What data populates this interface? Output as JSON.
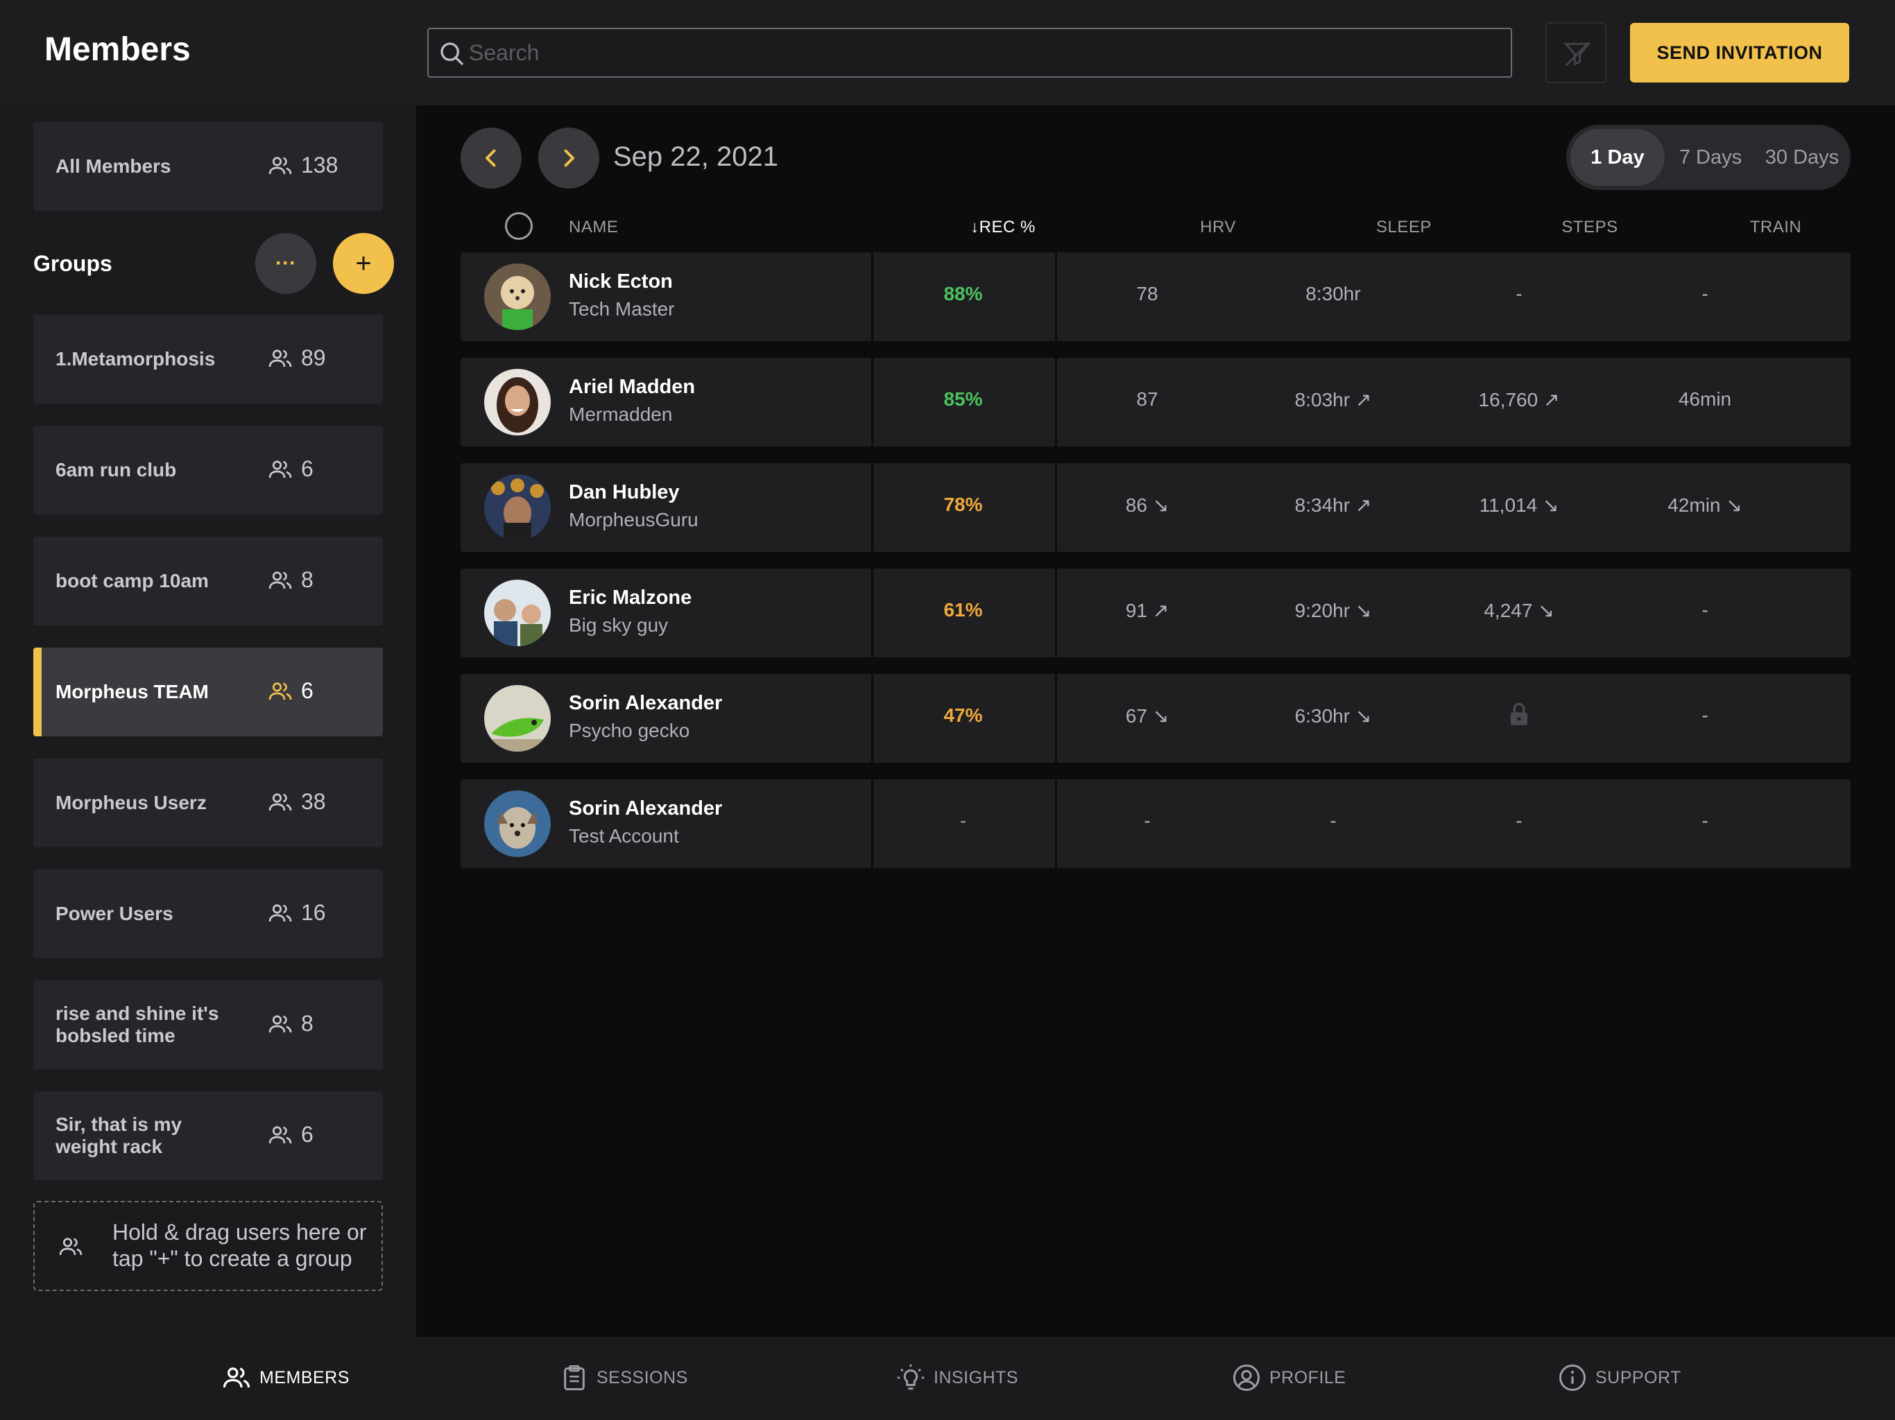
{
  "header": {
    "title": "Members",
    "search_placeholder": "Search",
    "invite_label": "SEND INVITATION"
  },
  "sidebar": {
    "all_members": {
      "label": "All Members",
      "count": "138"
    },
    "groups_label": "Groups",
    "more_label": "···",
    "add_label": "+",
    "groups": [
      {
        "label": "1.Metamorphosis",
        "count": "89"
      },
      {
        "label": "6am run club",
        "count": "6"
      },
      {
        "label": "boot camp 10am",
        "count": "8"
      },
      {
        "label": "Morpheus TEAM",
        "count": "6",
        "active": true
      },
      {
        "label": "Morpheus Userz",
        "count": "38"
      },
      {
        "label": "Power Users",
        "count": "16"
      },
      {
        "label": "rise and shine it's bobsled time",
        "count": "8"
      },
      {
        "label": "Sir, that is my weight rack",
        "count": "6"
      }
    ],
    "dropzone_text": "Hold & drag users here or tap \"+\" to create a group"
  },
  "toolbar": {
    "date": "Sep 22, 2021",
    "ranges": [
      "1 Day",
      "7 Days",
      "30 Days"
    ],
    "selected_range": "1 Day"
  },
  "table": {
    "headers": {
      "name": "NAME",
      "rec": "REC %",
      "hrv": "HRV",
      "sleep": "SLEEP",
      "steps": "STEPS",
      "train": "TRAIN"
    },
    "rows": [
      {
        "name": "Nick Ecton",
        "subtitle": "Tech Master",
        "rec": "88%",
        "rec_color": "#4cc35e",
        "hrv": "78",
        "sleep": "8:30hr",
        "steps": "-",
        "train": "-"
      },
      {
        "name": "Ariel Madden",
        "subtitle": "Mermadden",
        "rec": "85%",
        "rec_color": "#4cc35e",
        "hrv": "87",
        "sleep": "8:03hr ↗",
        "steps": "16,760 ↗",
        "train": "46min"
      },
      {
        "name": "Dan Hubley",
        "subtitle": "MorpheusGuru",
        "rec": "78%",
        "rec_color": "#f0a93a",
        "hrv": "86 ↘",
        "sleep": "8:34hr ↗",
        "steps": "11,014 ↘",
        "train": "42min ↘"
      },
      {
        "name": "Eric Malzone",
        "subtitle": "Big sky guy",
        "rec": "61%",
        "rec_color": "#f0a93a",
        "hrv": "91 ↗",
        "sleep": "9:20hr ↘",
        "steps": "4,247 ↘",
        "train": "-"
      },
      {
        "name": "Sorin Alexander",
        "subtitle": "Psycho gecko",
        "rec": "47%",
        "rec_color": "#f0a93a",
        "hrv": "67 ↘",
        "sleep": "6:30hr ↘",
        "steps": "",
        "steps_icon": "lock-icon",
        "train": "-"
      },
      {
        "name": "Sorin Alexander",
        "subtitle": "Test Account",
        "rec": "-",
        "rec_color": "#9d9da3",
        "hrv": "-",
        "sleep": "-",
        "steps": "-",
        "train": "-"
      }
    ]
  },
  "tabbar": {
    "tabs": [
      {
        "label": "MEMBERS",
        "icon": "members-icon",
        "active": true
      },
      {
        "label": "SESSIONS",
        "icon": "sessions-icon"
      },
      {
        "label": "INSIGHTS",
        "icon": "insights-icon"
      },
      {
        "label": "PROFILE",
        "icon": "profile-icon"
      },
      {
        "label": "SUPPORT",
        "icon": "support-icon"
      }
    ]
  },
  "colors": {
    "accent": "#f2c14b",
    "good": "#4cc35e",
    "warn": "#f0a93a"
  }
}
